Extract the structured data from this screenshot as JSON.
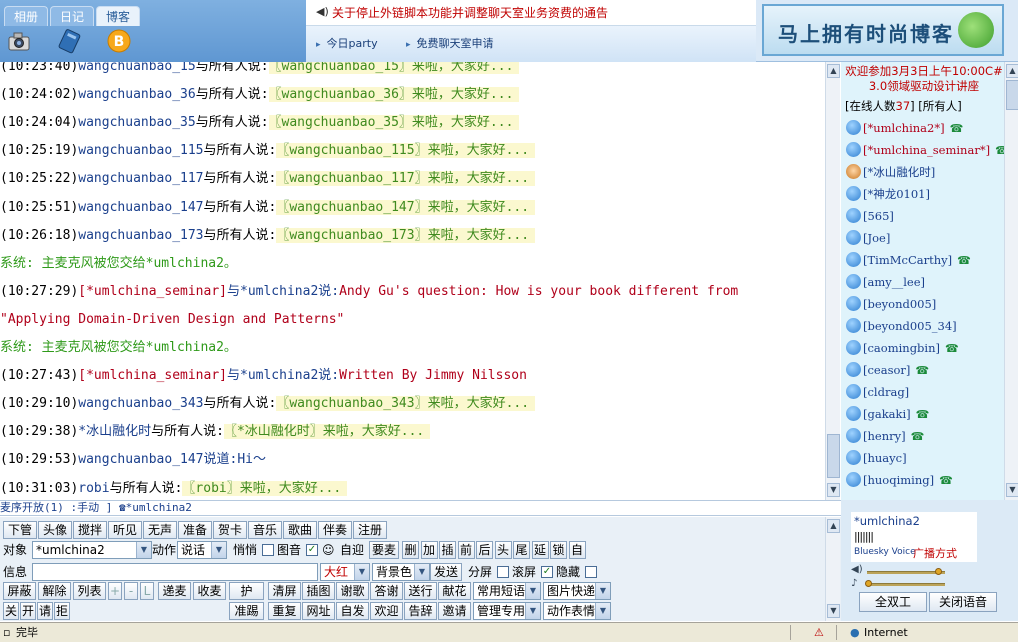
{
  "header": {
    "tabs": [
      "相册",
      "日记",
      "博客"
    ],
    "notice": "关于停止外链脚本功能并调整聊天室业务资费的通告",
    "links": [
      "今日party",
      "免费聊天室申请"
    ],
    "banner": "马上拥有时尚博客"
  },
  "messages": [
    {
      "time": "(10:23:40)",
      "name": "wangchuanbao_15",
      "say": "与所有人说:",
      "text": "〖wangchuanbao_15〗来啦，大家好..."
    },
    {
      "time": "(10:24:02)",
      "name": "wangchuanbao_36",
      "say": "与所有人说:",
      "text": "〖wangchuanbao_36〗来啦，大家好..."
    },
    {
      "time": "(10:24:04)",
      "name": "wangchuanbao_35",
      "say": "与所有人说:",
      "text": "〖wangchuanbao_35〗来啦，大家好..."
    },
    {
      "time": "(10:25:19)",
      "name": "wangchuanbao_115",
      "say": "与所有人说:",
      "text": "〖wangchuanbao_115〗来啦，大家好..."
    },
    {
      "time": "(10:25:22)",
      "name": "wangchuanbao_117",
      "say": "与所有人说:",
      "text": "〖wangchuanbao_117〗来啦，大家好..."
    },
    {
      "time": "(10:25:51)",
      "name": "wangchuanbao_147",
      "say": "与所有人说:",
      "text": "〖wangchuanbao_147〗来啦，大家好..."
    },
    {
      "time": "(10:26:18)",
      "name": "wangchuanbao_173",
      "say": "与所有人说:",
      "text": "〖wangchuanbao_173〗来啦，大家好..."
    },
    {
      "system": "系统:",
      "text": "主麦克风被您交给*umlchina2。"
    },
    {
      "time": "(10:27:29)",
      "name": "[*umlchina_seminar]",
      "to": "与*umlchina2说:",
      "red": "Andy Gu's question: How is your book different from"
    },
    {
      "red": "\"Applying Domain-Driven Design and Patterns\""
    },
    {
      "system": "系统:",
      "text": "主麦克风被您交给*umlchina2。"
    },
    {
      "time": "(10:27:43)",
      "name": "[*umlchina_seminar]",
      "to": "与*umlchina2说:",
      "red": "Written By Jimmy Nilsson"
    },
    {
      "time": "(10:29:10)",
      "name": "wangchuanbao_343",
      "say": "与所有人说:",
      "text": "〖wangchuanbao_343〗来啦，大家好..."
    },
    {
      "time": "(10:29:38)",
      "name": "*冰山融化时",
      "say": "与所有人说:",
      "text": "〖*冰山融化时〗来啦，大家好..."
    },
    {
      "time": "(10:29:53)",
      "name": "wangchuanbao_147",
      "say": "说道:",
      "blue": "Hi～"
    },
    {
      "time": "(10:31:03)",
      "name": "robi",
      "say": "与所有人说:",
      "text": "〖robi〗来啦，大家好..."
    }
  ],
  "userlist": {
    "welcome": "欢迎参加3月3日上午10:00C# 3.0领域驱动设计讲座",
    "online_prefix": "[在线人数",
    "online_count": "37",
    "online_suffix": "]",
    "all_label": "[所有人]",
    "users": [
      {
        "name": "[*umlchina2*]",
        "phone": true,
        "red": true
      },
      {
        "name": "[*umlchina_seminar*]",
        "phone": true,
        "red": true
      },
      {
        "name": "[*冰山融化时]",
        "phone": false,
        "face": true
      },
      {
        "name": "[*神龙0101]",
        "phone": false
      },
      {
        "name": "[565]",
        "phone": false
      },
      {
        "name": "[Joe]",
        "phone": false
      },
      {
        "name": "[TimMcCarthy]",
        "phone": true
      },
      {
        "name": "[amy__lee]",
        "phone": false
      },
      {
        "name": "[beyond005]",
        "phone": false
      },
      {
        "name": "[beyond005_34]",
        "phone": false
      },
      {
        "name": "[caomingbin]",
        "phone": true
      },
      {
        "name": "[ceasor]",
        "phone": true
      },
      {
        "name": "[cldrag]",
        "phone": false
      },
      {
        "name": "[gakaki]",
        "phone": true
      },
      {
        "name": "[henry]",
        "phone": true
      },
      {
        "name": "[huayc]",
        "phone": false
      },
      {
        "name": "[huoqiming]",
        "phone": true
      }
    ]
  },
  "micline": "麦序开放(1) :手动 ] ☎*umlchina2",
  "controls": {
    "row1": [
      "下管",
      "头像",
      "搅拌",
      "听见",
      "无声",
      "准备",
      "贺卡",
      "音乐",
      "歌曲",
      "伴奏",
      "注册"
    ],
    "target_label": "对象",
    "target_value": "*umlchina2",
    "action_label": "动作",
    "action_value": "说话",
    "quiet_label": "悄悄",
    "pic_label": "图音",
    "welcome_label": "自迎",
    "request_mic": "要麦",
    "mic_ops": [
      "删",
      "加",
      "插",
      "前",
      "后",
      "头",
      "尾",
      "延",
      "锁",
      "自"
    ],
    "info_label": "信息",
    "color_value": "大红",
    "bg_value": "背景色",
    "send": "发送",
    "split_label": "分屏",
    "scroll_label": "滚屏",
    "hide_label": "隐藏",
    "row3_left": [
      "屏蔽",
      "解除",
      "列表"
    ],
    "small_plus": "+",
    "small_minus": "-",
    "small_l": "L",
    "row3_mid": [
      "递麦",
      "收麦"
    ],
    "protect": "护",
    "row3_right": [
      "清屏",
      "插图",
      "谢歌",
      "答谢",
      "送行",
      "献花"
    ],
    "common_phrase": "常用短语",
    "pic_quick": "图片快递",
    "row4_left": [
      "关",
      "开",
      "请",
      "拒"
    ],
    "quasi_mic": "准踢",
    "row4_right": [
      "重复",
      "网址",
      "自发",
      "欢迎",
      "告辞",
      "邀请"
    ],
    "manager": "管理专用",
    "emote": "动作表情"
  },
  "voice": {
    "name": "*umlchina2",
    "bars": "|||||||",
    "brand": "Bluesky Voice",
    "mode": "广播方式",
    "btn_duplex": "全双工",
    "btn_close": "关闭语音"
  },
  "statusbar": {
    "status": "完毕",
    "zone": "Internet"
  }
}
